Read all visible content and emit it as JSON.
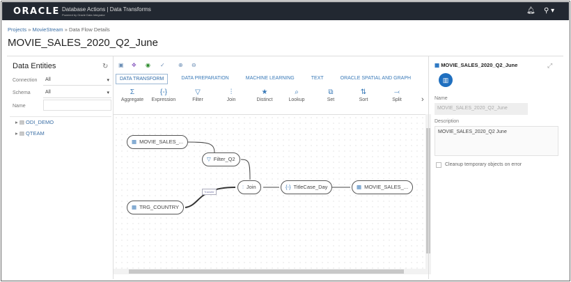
{
  "header": {
    "logo": "ORACLE",
    "app_title": "Database Actions | Data Transforms",
    "powered_by": "Powered by Oracle Data Integrator"
  },
  "breadcrumb": {
    "items": [
      "Projects",
      "MovieStream",
      "Data Flow Details"
    ],
    "sep": "»"
  },
  "page_title": "MOVIE_SALES_2020_Q2_June",
  "left": {
    "title": "Data Entities",
    "connection_label": "Connection",
    "connection_value": "All",
    "schema_label": "Schema",
    "schema_value": "All",
    "name_label": "Name",
    "name_value": "",
    "tree": [
      "ODI_DEMO",
      "QTEAM"
    ]
  },
  "canvas": {
    "tabs": [
      "DATA TRANSFORM",
      "DATA PREPARATION",
      "MACHINE LEARNING",
      "TEXT",
      "ORACLE SPATIAL AND GRAPH"
    ],
    "palette": [
      {
        "label": "Aggregate",
        "icon": "Σ"
      },
      {
        "label": "Expression",
        "icon": "{-}"
      },
      {
        "label": "Filter",
        "icon": "▽"
      },
      {
        "label": "Join",
        "icon": "⫶"
      },
      {
        "label": "Distinct",
        "icon": "★"
      },
      {
        "label": "Lookup",
        "icon": "⌕"
      },
      {
        "label": "Set",
        "icon": "⧉"
      },
      {
        "label": "Sort",
        "icon": "⇅"
      },
      {
        "label": "Split",
        "icon": "⤙"
      }
    ],
    "nodes": {
      "src": "MOVIE_SALES_...",
      "filter": "Filter_Q2",
      "join": "Join",
      "expr": "TitleCase_Day",
      "target": "MOVIE_SALES_...",
      "country": "TRG_COUNTRY"
    },
    "link_label": "Transfer"
  },
  "right": {
    "title": "MOVIE_SALES_2020_Q2_June",
    "name_label": "Name",
    "name_value": "MOVIE_SALES_2020_Q2_June",
    "desc_label": "Description",
    "desc_value": "MOVIE_SALES_2020_Q2 June",
    "cleanup_label": "Cleanup temporary objects on error"
  }
}
